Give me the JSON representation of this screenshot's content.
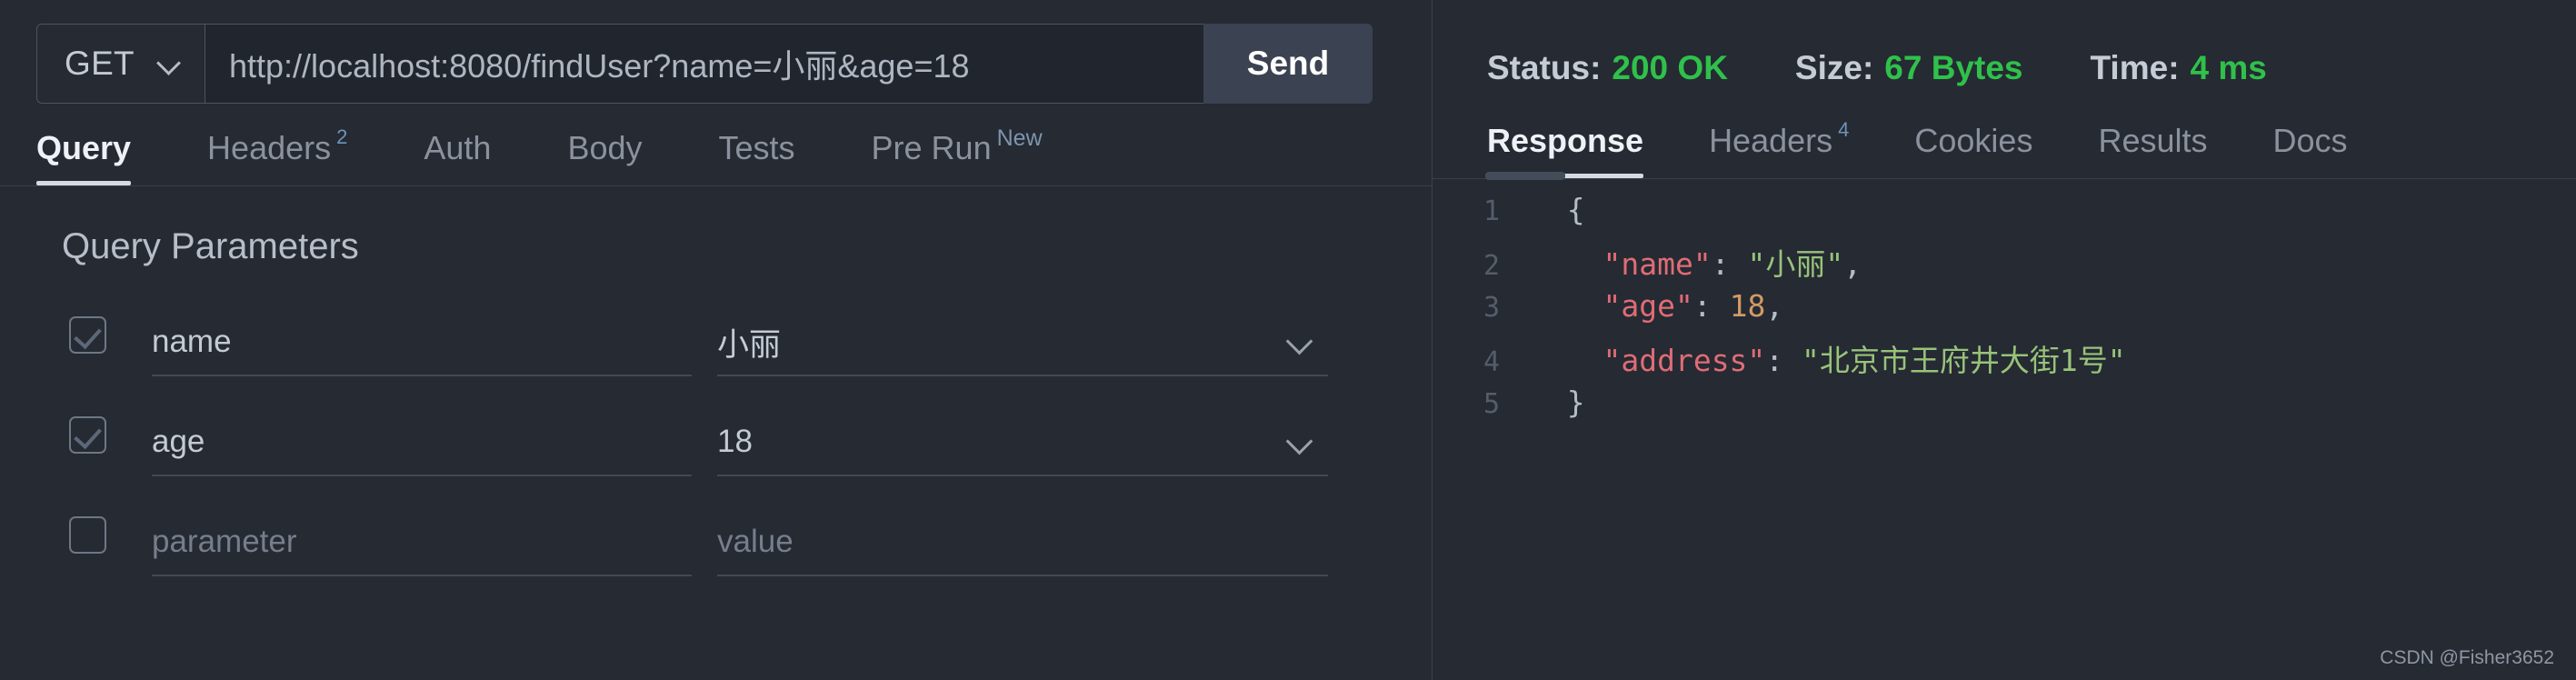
{
  "request": {
    "method": "GET",
    "method_icon": "chevron-down-icon",
    "url": "http://localhost:8080/findUser?name=小丽&age=18",
    "send_label": "Send"
  },
  "request_tabs": [
    {
      "label": "Query",
      "badge": "",
      "active": true
    },
    {
      "label": "Headers",
      "badge": "2",
      "active": false
    },
    {
      "label": "Auth",
      "badge": "",
      "active": false
    },
    {
      "label": "Body",
      "badge": "",
      "active": false
    },
    {
      "label": "Tests",
      "badge": "",
      "active": false
    },
    {
      "label": "Pre Run",
      "badge": "New",
      "active": false
    }
  ],
  "query_params": {
    "section_title": "Query Parameters",
    "rows": [
      {
        "checked": true,
        "key": "name",
        "value": "小丽",
        "key_placeholder": "",
        "value_placeholder": "",
        "has_dropdown": true
      },
      {
        "checked": true,
        "key": "age",
        "value": "18",
        "key_placeholder": "",
        "value_placeholder": "",
        "has_dropdown": true
      },
      {
        "checked": false,
        "key": "",
        "value": "",
        "key_placeholder": "parameter",
        "value_placeholder": "value",
        "has_dropdown": false
      }
    ]
  },
  "response_status": [
    {
      "key": "Status:",
      "value": "200 OK",
      "color": "#2fc14a"
    },
    {
      "key": "Size:",
      "value": "67 Bytes",
      "color": "#2fc14a"
    },
    {
      "key": "Time:",
      "value": "4 ms",
      "color": "#2fc14a"
    }
  ],
  "response_tabs": [
    {
      "label": "Response",
      "badge": "",
      "active": true
    },
    {
      "label": "Headers",
      "badge": "4",
      "active": false
    },
    {
      "label": "Cookies",
      "badge": "",
      "active": false
    },
    {
      "label": "Results",
      "badge": "",
      "active": false
    },
    {
      "label": "Docs",
      "badge": "",
      "active": false
    }
  ],
  "response_body": {
    "language": "json",
    "lines": [
      {
        "n": "1",
        "tokens": [
          {
            "t": "  {",
            "c": "tok-punc"
          }
        ]
      },
      {
        "n": "2",
        "tokens": [
          {
            "t": "    ",
            "c": "tok-punc"
          },
          {
            "t": "\"name\"",
            "c": "tok-key"
          },
          {
            "t": ": ",
            "c": "tok-punc"
          },
          {
            "t": "\"小丽\"",
            "c": "tok-str"
          },
          {
            "t": ",",
            "c": "tok-punc"
          }
        ]
      },
      {
        "n": "3",
        "tokens": [
          {
            "t": "    ",
            "c": "tok-punc"
          },
          {
            "t": "\"age\"",
            "c": "tok-key"
          },
          {
            "t": ": ",
            "c": "tok-punc"
          },
          {
            "t": "18",
            "c": "tok-num"
          },
          {
            "t": ",",
            "c": "tok-punc"
          }
        ]
      },
      {
        "n": "4",
        "tokens": [
          {
            "t": "    ",
            "c": "tok-punc"
          },
          {
            "t": "\"address\"",
            "c": "tok-key"
          },
          {
            "t": ": ",
            "c": "tok-punc"
          },
          {
            "t": "\"北京市王府井大街1号\"",
            "c": "tok-str"
          }
        ]
      },
      {
        "n": "5",
        "tokens": [
          {
            "t": "  }",
            "c": "tok-punc"
          }
        ]
      }
    ]
  },
  "watermark": "CSDN @Fisher3652"
}
